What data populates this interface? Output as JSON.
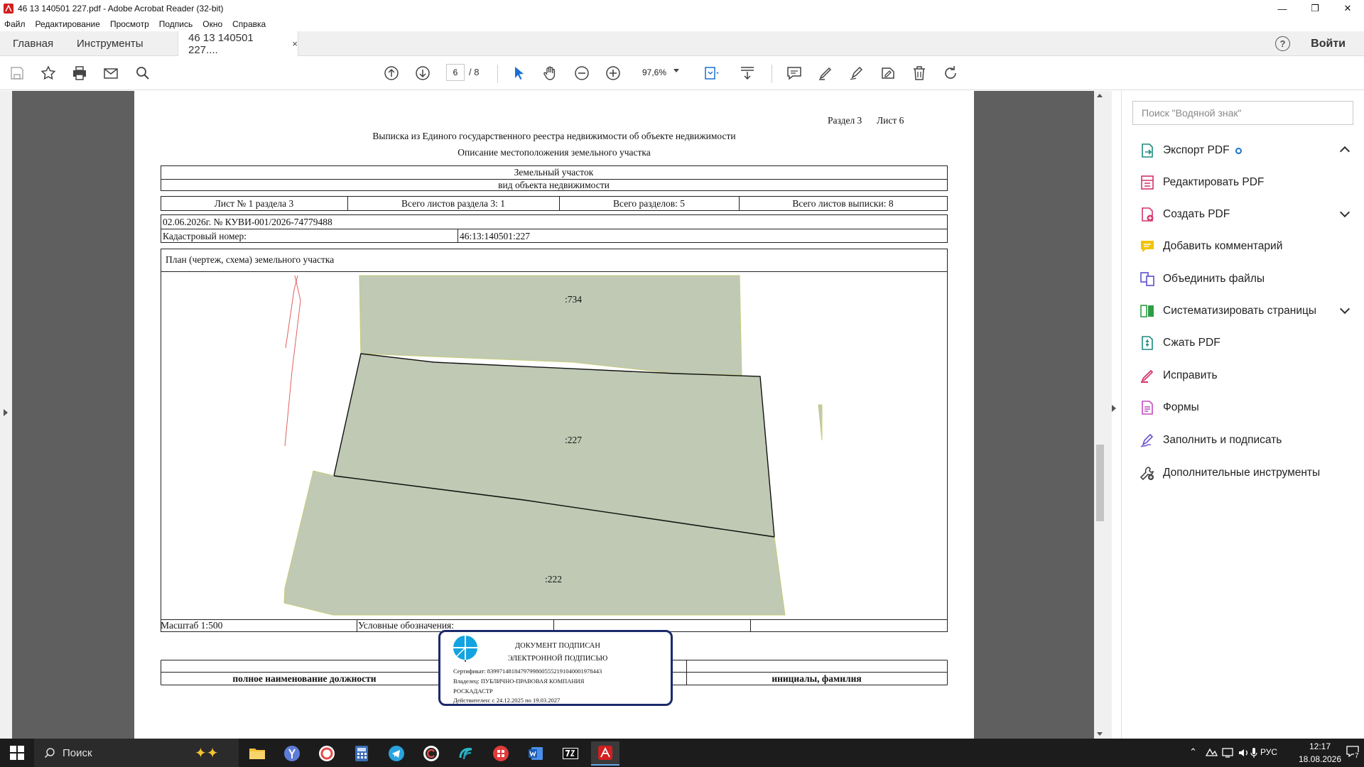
{
  "window": {
    "title": "46 13 140501 227.pdf - Adobe Acrobat Reader (32-bit)",
    "minimize": "—",
    "maximize": "❐",
    "close": "✕"
  },
  "menu": {
    "items": [
      "Файл",
      "Редактирование",
      "Просмотр",
      "Подпись",
      "Окно",
      "Справка"
    ]
  },
  "tabs": {
    "home": "Главная",
    "tools": "Инструменты",
    "document": "46 13 140501 227....",
    "close": "×",
    "help": "?",
    "signin": "Войти"
  },
  "toolbar": {
    "current_page": "6",
    "total_pages": "/ 8",
    "zoom": "97,6%"
  },
  "document": {
    "section": "Раздел 3",
    "sheet": "Лист 6",
    "title": "Выписка из Единого государственного реестра недвижимости об объекте недвижимости",
    "subtitle": "Описание местоположения земельного участка",
    "object_type": "Земельный участок",
    "object_type_caption": "вид объекта недвижимости",
    "sheet_no": "Лист № 1 раздела 3",
    "sheets_in_section": "Всего листов раздела 3: 1",
    "sections_total": "Всего разделов: 5",
    "sheets_total": "Всего листов выписки: 8",
    "date_number": "02.06.2026г. № КУВИ-001/2026-74779488",
    "cadastral_label": "Кадастровый номер:",
    "cadastral_value": "46:13:140501:227",
    "plan_title": "План (чертеж, схема) земельного участка",
    "parcel_top": ":734",
    "parcel_mid": ":227",
    "parcel_bottom": ":222",
    "scale": "Масштаб 1:500",
    "legend_label": "Условные обозначения:",
    "position_caption": "полное наименование должности",
    "name_caption": "инициалы, фамилия"
  },
  "signature": {
    "line1": "ДОКУМЕНТ ПОДПИСАН",
    "line2": "ЭЛЕКТРОННОЙ ПОДПИСЬЮ",
    "certificate": "Сертификат: 839971481847979980055521910400019784​43",
    "owner": "Владелец: ПУБЛИЧНО-ПРАВОВАЯ КОМПАНИЯ",
    "owner2": "РОСКАДАСТР",
    "valid": "Действителен: с 24.12.2025 по 19.03.2027"
  },
  "tools_panel": {
    "search_placeholder": "Поиск \"Водяной знак\"",
    "items": [
      {
        "label": "Экспорт PDF",
        "icon": "export-pdf-icon",
        "color": "#1e8c7e"
      },
      {
        "label": "Редактировать PDF",
        "icon": "edit-pdf-icon",
        "color": "#d6336c"
      },
      {
        "label": "Создать PDF",
        "icon": "create-pdf-icon",
        "color": "#d6336c"
      },
      {
        "label": "Добавить комментарий",
        "icon": "comment-icon",
        "color": "#e8b400"
      },
      {
        "label": "Объединить файлы",
        "icon": "combine-files-icon",
        "color": "#5a4fcf"
      },
      {
        "label": "Систематизировать страницы",
        "icon": "organize-pages-icon",
        "color": "#2e9e44"
      },
      {
        "label": "Сжать PDF",
        "icon": "compress-pdf-icon",
        "color": "#1e8c7e"
      },
      {
        "label": "Исправить",
        "icon": "redact-icon",
        "color": "#d6336c"
      },
      {
        "label": "Формы",
        "icon": "forms-icon",
        "color": "#c24ac2"
      },
      {
        "label": "Заполнить и подписать",
        "icon": "fill-sign-icon",
        "color": "#6a4fcf"
      },
      {
        "label": "Дополнительные инструменты",
        "icon": "more-tools-icon",
        "color": "#444444"
      }
    ]
  },
  "taskbar": {
    "search": "Поиск",
    "lang": "РУС",
    "time": "12:17",
    "date": "18.08.2026",
    "notifications": "7"
  },
  "colors": {
    "parcel_fill": "#bfc9b4",
    "accent_blue": "#1a73c9",
    "stamp_border": "#1b2a6b"
  }
}
